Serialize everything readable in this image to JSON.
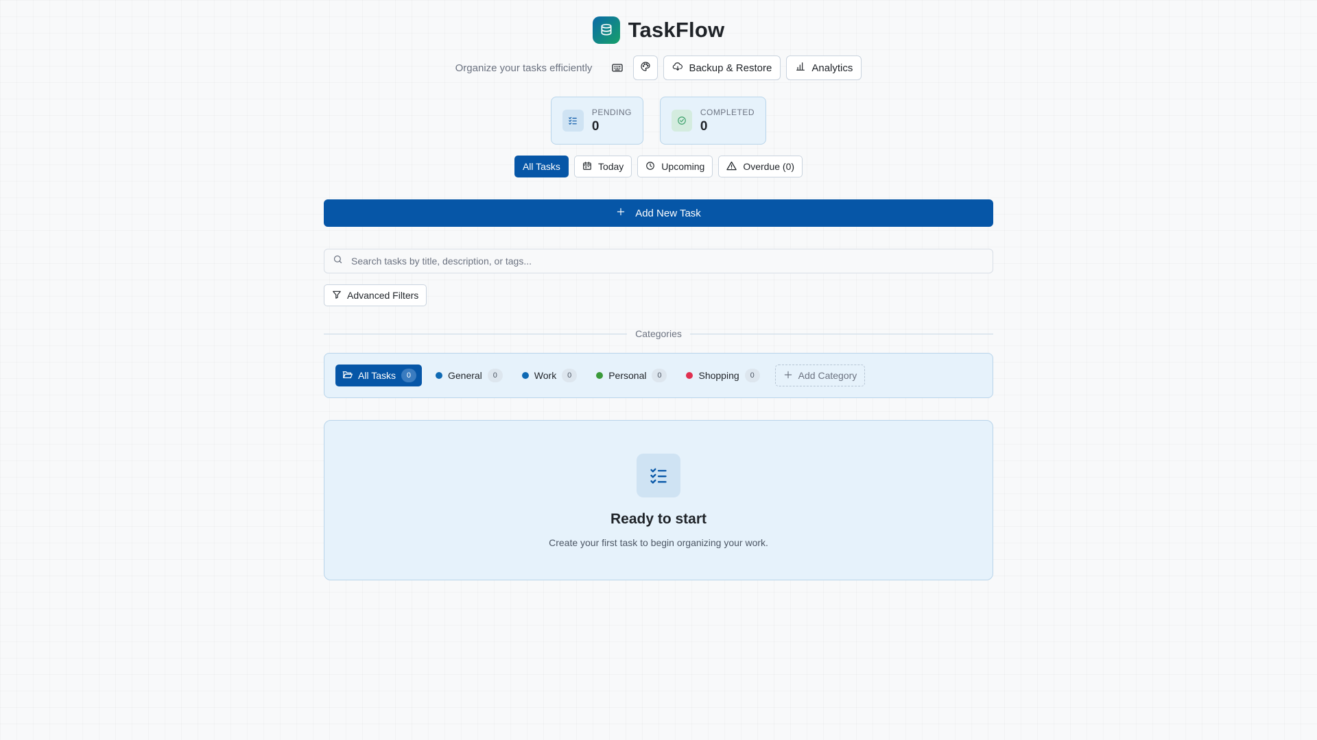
{
  "app": {
    "title": "TaskFlow",
    "subtitle": "Organize your tasks efficiently",
    "logo_icon": "database-icon"
  },
  "toolbar": {
    "keyboard_icon": "keyboard-icon",
    "theme_icon": "palette-icon",
    "backup_label": "Backup & Restore",
    "analytics_label": "Analytics"
  },
  "stats": {
    "pending_label": "PENDING",
    "pending_value": "0",
    "completed_label": "COMPLETED",
    "completed_value": "0"
  },
  "filters": {
    "all_label": "All Tasks",
    "today_label": "Today",
    "upcoming_label": "Upcoming",
    "overdue_label": "Overdue (0)",
    "active": "All Tasks"
  },
  "add_task_label": "Add New Task",
  "search": {
    "placeholder": "Search tasks by title, description, or tags...",
    "value": ""
  },
  "advanced_filters_label": "Advanced Filters",
  "categories": {
    "heading": "Categories",
    "items": [
      {
        "label": "All Tasks",
        "count": "0",
        "active": true
      },
      {
        "label": "General",
        "count": "0",
        "color": "#0f6ab4"
      },
      {
        "label": "Work",
        "count": "0",
        "color": "#0f6ab4"
      },
      {
        "label": "Personal",
        "count": "0",
        "color": "#3a9a3a"
      },
      {
        "label": "Shopping",
        "count": "0",
        "color": "#e03050"
      }
    ],
    "add_label": "Add Category"
  },
  "empty_state": {
    "title": "Ready to start",
    "text": "Create your first task to begin organizing your work."
  },
  "colors": {
    "primary": "#0656a7",
    "card_bg": "#e6f2fb",
    "card_border": "#b8d4ea",
    "success": "#3aa06a"
  }
}
